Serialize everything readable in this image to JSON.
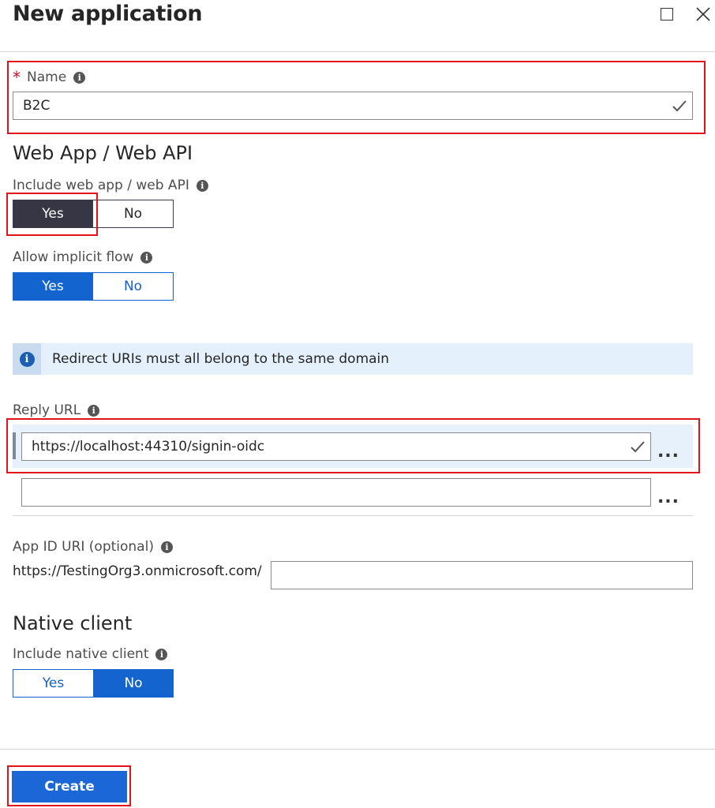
{
  "header": {
    "title": "New application"
  },
  "name_field": {
    "required_mark": "*",
    "label": "Name",
    "value": "B2C"
  },
  "web_app": {
    "section_title": "Web App / Web API",
    "include_label": "Include web app / web API",
    "include_yes": "Yes",
    "include_no": "No",
    "include_selected": "Yes",
    "implicit_label": "Allow implicit flow",
    "implicit_yes": "Yes",
    "implicit_no": "No",
    "implicit_selected": "Yes"
  },
  "banner": {
    "text": "Redirect URIs must all belong to the same domain"
  },
  "reply_url": {
    "label": "Reply URL",
    "values": [
      "https://localhost:44310/signin-oidc",
      ""
    ],
    "more_label": "..."
  },
  "app_id_uri": {
    "label": "App ID URI (optional)",
    "prefix": "https://TestingOrg3.onmicrosoft.com/",
    "value": ""
  },
  "native_client": {
    "section_title": "Native client",
    "include_label": "Include native client",
    "yes": "Yes",
    "no": "No",
    "selected": "No"
  },
  "footer": {
    "create_label": "Create"
  },
  "colors": {
    "highlight_box": "#e3131b",
    "toggle_dark": "#363645",
    "toggle_blue": "#1464d0",
    "create_button": "#1b67d8",
    "banner_bg": "#e4f0fb"
  }
}
